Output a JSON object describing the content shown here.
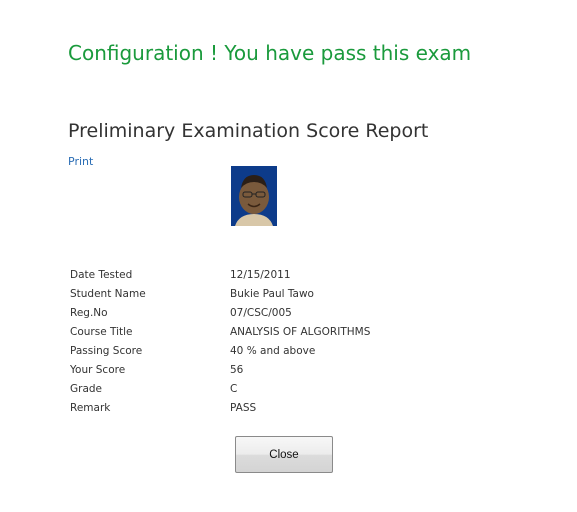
{
  "banner": "Configuration ! You have pass this exam",
  "report": {
    "title": "Preliminary Examination Score Report",
    "print_label": "Print"
  },
  "details": [
    {
      "label": "Date Tested",
      "value": "12/15/2011"
    },
    {
      "label": "Student Name",
      "value": "Bukie Paul Tawo"
    },
    {
      "label": "Reg.No",
      "value": "07/CSC/005"
    },
    {
      "label": "Course Title",
      "value": "ANALYSIS OF ALGORITHMS"
    },
    {
      "label": "Passing Score",
      "value": "40 % and above"
    },
    {
      "label": "Your Score",
      "value": "56"
    },
    {
      "label": "Grade",
      "value": "C"
    },
    {
      "label": "Remark",
      "value": "PASS"
    }
  ],
  "actions": {
    "close_label": "Close"
  },
  "colors": {
    "banner": "#1a9a3c",
    "link": "#2a6db5",
    "text": "#333333"
  }
}
